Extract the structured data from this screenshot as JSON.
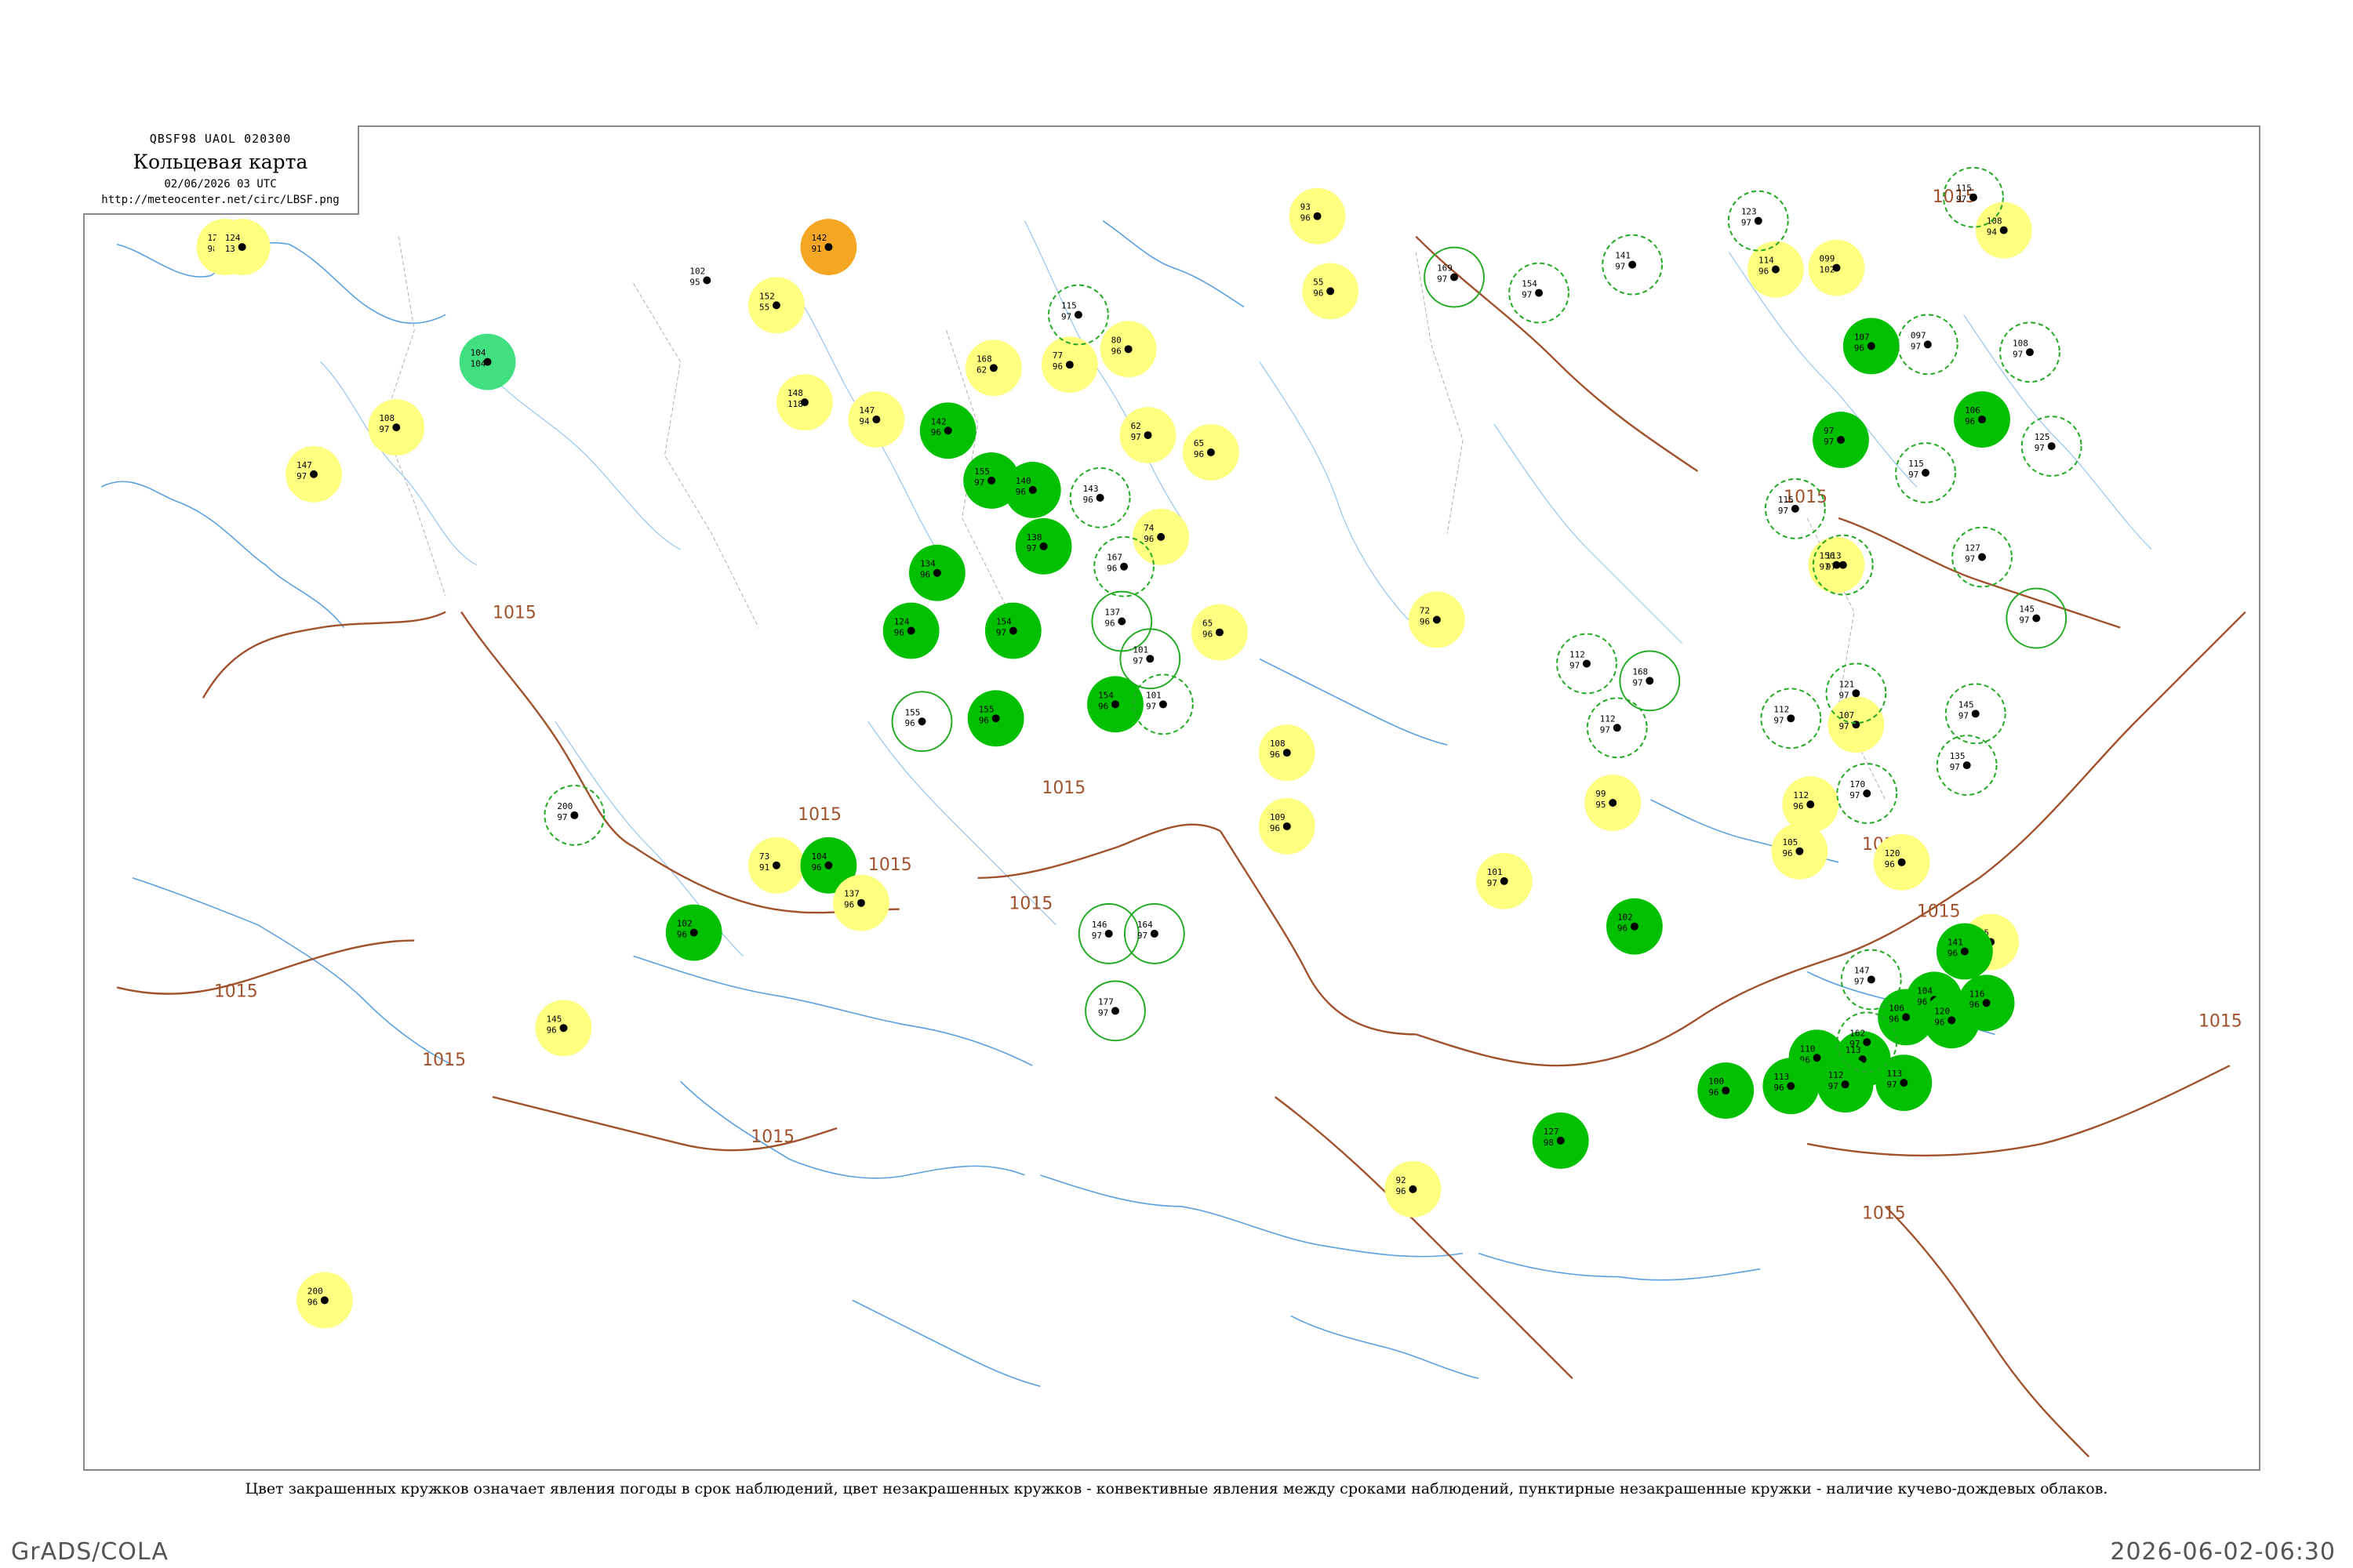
{
  "header": {
    "code_line": "QBSF98  UAOL  020300",
    "title": "Кольцевая карта",
    "date_line": "02/06/2026 03 UTC",
    "url": "http://meteocenter.net/circ/LBSF.png"
  },
  "caption": "Цвет закрашенных кружков означает явления погоды в срок наблюдений, цвет незакрашенных кружков - конвективные явления между сроками наблюдений, пунктирные незакрашенные кружки - наличие кучево-дождевых облаков.",
  "footer": {
    "left": "GrADS/COLA",
    "right": "2026-06-02-06:30"
  },
  "isobar_label": "1015",
  "colors": {
    "frame": "#8a8a8a",
    "isobar": "#a0522d",
    "coast": "#5aa0e0",
    "river": "#8ec0ef",
    "border": "#b0b0b0",
    "fill_green": "#00c000",
    "fill_yellow": "#ffff80",
    "fill_orange": "#f5a623",
    "fill_lightgreen": "#40e080",
    "outline_green": "#22aa22"
  },
  "stations": [
    {
      "p": [
        0.064,
        0.0894
      ],
      "t": "123",
      "b": "98",
      "fill": "yellow"
    },
    {
      "p": [
        0.072,
        0.0894
      ],
      "t": "124",
      "b": "13",
      "fill": "yellow"
    },
    {
      "p": [
        0.185,
        0.175
      ],
      "t": "104",
      "b": "104",
      "fill": "lightgreen"
    },
    {
      "p": [
        0.143,
        0.2238
      ],
      "t": "108",
      "b": "97",
      "fill": "yellow"
    },
    {
      "p": [
        0.105,
        0.2587
      ],
      "t": "147",
      "b": "97",
      "fill": "yellow"
    },
    {
      "p": [
        0.286,
        0.1142
      ],
      "t": "102",
      "b": "95",
      "fill": "none"
    },
    {
      "p": [
        0.342,
        0.0894
      ],
      "t": "142",
      "b": "91",
      "fill": "orange"
    },
    {
      "p": [
        0.318,
        0.1328
      ],
      "t": "152",
      "b": "55",
      "fill": "yellow"
    },
    {
      "p": [
        0.331,
        0.2051
      ],
      "t": "148",
      "b": "118",
      "fill": "yellow"
    },
    {
      "p": [
        0.364,
        0.2179
      ],
      "t": "147",
      "b": "94",
      "fill": "yellow"
    },
    {
      "p": [
        0.418,
        0.1795
      ],
      "t": "168",
      "b": "62",
      "fill": "yellow"
    },
    {
      "p": [
        0.397,
        0.2262
      ],
      "t": "142",
      "b": "96",
      "fill": "green"
    },
    {
      "p": [
        0.417,
        0.2634
      ],
      "t": "155",
      "b": "97",
      "fill": "green"
    },
    {
      "p": [
        0.436,
        0.2704
      ],
      "t": "140",
      "b": "96",
      "fill": "green"
    },
    {
      "p": [
        0.441,
        0.3124
      ],
      "t": "138",
      "b": "97",
      "fill": "green"
    },
    {
      "p": [
        0.392,
        0.3322
      ],
      "t": "134",
      "b": "96",
      "fill": "green"
    },
    {
      "p": [
        0.38,
        0.3753
      ],
      "t": "124",
      "b": "96",
      "fill": "green"
    },
    {
      "p": [
        0.427,
        0.3753
      ],
      "t": "154",
      "b": "97",
      "fill": "green"
    },
    {
      "p": [
        0.419,
        0.4406
      ],
      "t": "155",
      "b": "96",
      "fill": "green"
    },
    {
      "p": [
        0.474,
        0.4301
      ],
      "t": "154",
      "b": "96",
      "fill": "green"
    },
    {
      "p": [
        0.318,
        0.5501
      ],
      "t": "73",
      "b": "91",
      "fill": "yellow"
    },
    {
      "p": [
        0.342,
        0.5501
      ],
      "t": "104",
      "b": "96",
      "fill": "green"
    },
    {
      "p": [
        0.28,
        0.6002
      ],
      "t": "102",
      "b": "96",
      "fill": "green"
    },
    {
      "p": [
        0.357,
        0.5781
      ],
      "t": "137",
      "b": "96",
      "fill": "yellow"
    },
    {
      "p": [
        0.22,
        0.6713
      ],
      "t": "145",
      "b": "96",
      "fill": "yellow"
    },
    {
      "p": [
        0.11,
        0.8741
      ],
      "t": "200",
      "b": "96",
      "fill": "yellow"
    },
    {
      "p": [
        0.453,
        0.1771
      ],
      "t": "77",
      "b": "96",
      "fill": "yellow"
    },
    {
      "p": [
        0.48,
        0.1655
      ],
      "t": "80",
      "b": "96",
      "fill": "yellow"
    },
    {
      "p": [
        0.489,
        0.2296
      ],
      "t": "62",
      "b": "97",
      "fill": "yellow"
    },
    {
      "p": [
        0.518,
        0.2424
      ],
      "t": "65",
      "b": "96",
      "fill": "yellow"
    },
    {
      "p": [
        0.495,
        0.3054
      ],
      "t": "74",
      "b": "96",
      "fill": "yellow"
    },
    {
      "p": [
        0.522,
        0.3765
      ],
      "t": "65",
      "b": "96",
      "fill": "yellow"
    },
    {
      "p": [
        0.553,
        0.4662
      ],
      "t": "108",
      "b": "96",
      "fill": "yellow"
    },
    {
      "p": [
        0.553,
        0.521
      ],
      "t": "109",
      "b": "96",
      "fill": "yellow"
    },
    {
      "p": [
        0.567,
        0.0664
      ],
      "t": "93",
      "b": "96",
      "fill": "yellow"
    },
    {
      "p": [
        0.573,
        0.1223
      ],
      "t": "55",
      "b": "96",
      "fill": "yellow"
    },
    {
      "p": [
        0.622,
        0.3671
      ],
      "t": "72",
      "b": "96",
      "fill": "yellow"
    },
    {
      "p": [
        0.703,
        0.5035
      ],
      "t": "99",
      "b": "95",
      "fill": "yellow"
    },
    {
      "p": [
        0.653,
        0.5618
      ],
      "t": "101",
      "b": "97",
      "fill": "yellow"
    },
    {
      "p": [
        0.611,
        0.7914
      ],
      "t": "92",
      "b": "96",
      "fill": "yellow"
    },
    {
      "p": [
        0.679,
        0.7552
      ],
      "t": "127",
      "b": "98",
      "fill": "green"
    },
    {
      "p": [
        0.713,
        0.5956
      ],
      "t": "102",
      "b": "96",
      "fill": "green"
    },
    {
      "p": [
        0.778,
        0.1061
      ],
      "t": "114",
      "b": "96",
      "fill": "yellow"
    },
    {
      "p": [
        0.806,
        0.1049
      ],
      "t": "099",
      "b": "102",
      "fill": "yellow"
    },
    {
      "p": [
        0.822,
        0.1632
      ],
      "t": "107",
      "b": "96",
      "fill": "green"
    },
    {
      "p": [
        0.808,
        0.2331
      ],
      "t": "97",
      "b": "97",
      "fill": "green"
    },
    {
      "p": [
        0.883,
        0.0769
      ],
      "t": "108",
      "b": "94",
      "fill": "yellow"
    },
    {
      "p": [
        0.873,
        0.2179
      ],
      "t": "106",
      "b": "96",
      "fill": "green"
    },
    {
      "p": [
        0.806,
        0.3263
      ],
      "t": "156",
      "b": "97",
      "fill": "yellow"
    },
    {
      "p": [
        0.815,
        0.4452
      ],
      "t": "107",
      "b": "97",
      "fill": "yellow"
    },
    {
      "p": [
        0.794,
        0.5047
      ],
      "t": "112",
      "b": "96",
      "fill": "yellow"
    },
    {
      "p": [
        0.789,
        0.5396
      ],
      "t": "105",
      "b": "96",
      "fill": "yellow"
    },
    {
      "p": [
        0.836,
        0.5478
      ],
      "t": "120",
      "b": "96",
      "fill": "yellow"
    },
    {
      "p": [
        0.877,
        0.6072
      ],
      "t": "145",
      "b": "96",
      "fill": "yellow"
    },
    {
      "p": [
        0.838,
        0.6632
      ],
      "t": "106",
      "b": "96",
      "fill": "green"
    },
    {
      "p": [
        0.851,
        0.6503
      ],
      "t": "104",
      "b": "96",
      "fill": "green"
    },
    {
      "p": [
        0.797,
        0.6935
      ],
      "t": "110",
      "b": "96",
      "fill": "green"
    },
    {
      "p": [
        0.818,
        0.6946
      ],
      "t": "113",
      "b": "96",
      "fill": "green"
    },
    {
      "p": [
        0.865,
        0.6142
      ],
      "t": "141",
      "b": "96",
      "fill": "green"
    },
    {
      "p": [
        0.859,
        0.6655
      ],
      "t": "120",
      "b": "96",
      "fill": "green"
    },
    {
      "p": [
        0.875,
        0.6526
      ],
      "t": "116",
      "b": "96",
      "fill": "green"
    },
    {
      "p": [
        0.785,
        0.7145
      ],
      "t": "113",
      "b": "96",
      "fill": "green"
    },
    {
      "p": [
        0.81,
        0.7133
      ],
      "t": "112",
      "b": "97",
      "fill": "green"
    },
    {
      "p": [
        0.837,
        0.7121
      ],
      "t": "113",
      "b": "97",
      "fill": "green"
    },
    {
      "p": [
        0.755,
        0.7179
      ],
      "t": "100",
      "b": "96",
      "fill": "green"
    },
    {
      "p": [
        0.225,
        0.5128
      ],
      "t": "200",
      "b": "97",
      "fill": "outline-dashed"
    },
    {
      "p": [
        0.385,
        0.4429
      ],
      "t": "155",
      "b": "96",
      "fill": "outline"
    },
    {
      "p": [
        0.457,
        0.1399
      ],
      "t": "115",
      "b": "97",
      "fill": "outline-dashed"
    },
    {
      "p": [
        0.467,
        0.2762
      ],
      "t": "143",
      "b": "96",
      "fill": "outline-dashed"
    },
    {
      "p": [
        0.478,
        0.3275
      ],
      "t": "167",
      "b": "96",
      "fill": "outline-dashed"
    },
    {
      "p": [
        0.477,
        0.3683
      ],
      "t": "137",
      "b": "96",
      "fill": "outline"
    },
    {
      "p": [
        0.49,
        0.3962
      ],
      "t": "101",
      "b": "97",
      "fill": "outline"
    },
    {
      "p": [
        0.496,
        0.4301
      ],
      "t": "101",
      "b": "97",
      "fill": "outline-dashed"
    },
    {
      "p": [
        0.471,
        0.601
      ],
      "t": "146",
      "b": "97",
      "fill": "outline"
    },
    {
      "p": [
        0.492,
        0.601
      ],
      "t": "164",
      "b": "97",
      "fill": "outline"
    },
    {
      "p": [
        0.474,
        0.6585
      ],
      "t": "177",
      "b": "97",
      "fill": "outline"
    },
    {
      "p": [
        0.63,
        0.1119
      ],
      "t": "169",
      "b": "97",
      "fill": "outline"
    },
    {
      "p": [
        0.669,
        0.1236
      ],
      "t": "154",
      "b": "97",
      "fill": "outline-dashed"
    },
    {
      "p": [
        0.712,
        0.1026
      ],
      "t": "141",
      "b": "97",
      "fill": "outline-dashed"
    },
    {
      "p": [
        0.72,
        0.4126
      ],
      "t": "168",
      "b": "97",
      "fill": "outline"
    },
    {
      "p": [
        0.705,
        0.4476
      ],
      "t": "112",
      "b": "97",
      "fill": "outline-dashed"
    },
    {
      "p": [
        0.691,
        0.3998
      ],
      "t": "112",
      "b": "97",
      "fill": "outline-dashed"
    },
    {
      "p": [
        0.77,
        0.0699
      ],
      "t": "123",
      "b": "97",
      "fill": "outline-dashed"
    },
    {
      "p": [
        0.869,
        0.0524
      ],
      "t": "115",
      "b": "97",
      "fill": "outline-dashed"
    },
    {
      "p": [
        0.848,
        0.162
      ],
      "t": "097",
      "b": "97",
      "fill": "outline-dashed"
    },
    {
      "p": [
        0.895,
        0.1678
      ],
      "t": "108",
      "b": "97",
      "fill": "outline-dashed"
    },
    {
      "p": [
        0.847,
        0.2576
      ],
      "t": "115",
      "b": "97",
      "fill": "outline-dashed"
    },
    {
      "p": [
        0.809,
        0.3263
      ],
      "t": "113",
      "b": "97",
      "fill": "outline-dashed"
    },
    {
      "p": [
        0.905,
        0.2378
      ],
      "t": "125",
      "b": "97",
      "fill": "outline-dashed"
    },
    {
      "p": [
        0.873,
        0.3204
      ],
      "t": "127",
      "b": "97",
      "fill": "outline-dashed"
    },
    {
      "p": [
        0.898,
        0.366
      ],
      "t": "145",
      "b": "97",
      "fill": "outline"
    },
    {
      "p": [
        0.815,
        0.4219
      ],
      "t": "121",
      "b": "97",
      "fill": "outline-dashed"
    },
    {
      "p": [
        0.785,
        0.4406
      ],
      "t": "112",
      "b": "97",
      "fill": "outline-dashed"
    },
    {
      "p": [
        0.87,
        0.4371
      ],
      "t": "145",
      "b": "97",
      "fill": "outline-dashed"
    },
    {
      "p": [
        0.866,
        0.4755
      ],
      "t": "135",
      "b": "97",
      "fill": "outline-dashed"
    },
    {
      "p": [
        0.822,
        0.6352
      ],
      "t": "147",
      "b": "97",
      "fill": "outline-dashed"
    },
    {
      "p": [
        0.82,
        0.6818
      ],
      "t": "162",
      "b": "97",
      "fill": "outline-dashed"
    },
    {
      "p": [
        0.787,
        0.2844
      ],
      "t": "115",
      "b": "97",
      "fill": "outline-dashed"
    },
    {
      "p": [
        0.82,
        0.4965
      ],
      "t": "170",
      "b": "97",
      "fill": "outline-dashed"
    }
  ]
}
